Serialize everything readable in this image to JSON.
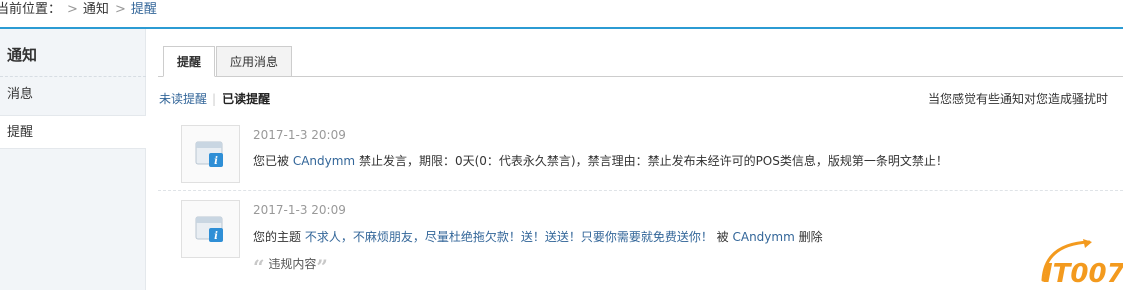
{
  "breadcrumb": {
    "label": "当前位置：",
    "items": [
      "通知",
      "提醒"
    ]
  },
  "sidebar": {
    "title": "通知",
    "items": [
      {
        "label": "消息"
      },
      {
        "label": "提醒"
      }
    ]
  },
  "tabs": [
    {
      "label": "提醒"
    },
    {
      "label": "应用消息"
    }
  ],
  "filters": {
    "unread": "未读提醒",
    "separator": "|",
    "read": "已读提醒"
  },
  "hint": "当您感觉有些通知对您造成骚扰时",
  "notices": [
    {
      "time": "2017-1-3 20:09",
      "prefix": "您已被 ",
      "user": "CAndymm",
      "suffix": " 禁止发言，期限：0天(0：代表永久禁言)，禁言理由：禁止发布未经许可的POS类信息，版规第一条明文禁止！"
    },
    {
      "time": "2017-1-3 20:09",
      "prefix": "您的主题 ",
      "topic": "不求人，不麻烦朋友，尽量杜绝拖欠款！送！送送！只要你需要就免费送你！",
      "middle": " 被 ",
      "user": "CAndymm",
      "suffix": " 删除",
      "quote": "违规内容"
    }
  ],
  "watermark": {
    "text": "IT007",
    "color": "#f39a1e"
  },
  "colors": {
    "accent": "#2b9bd3",
    "link": "#336699"
  }
}
